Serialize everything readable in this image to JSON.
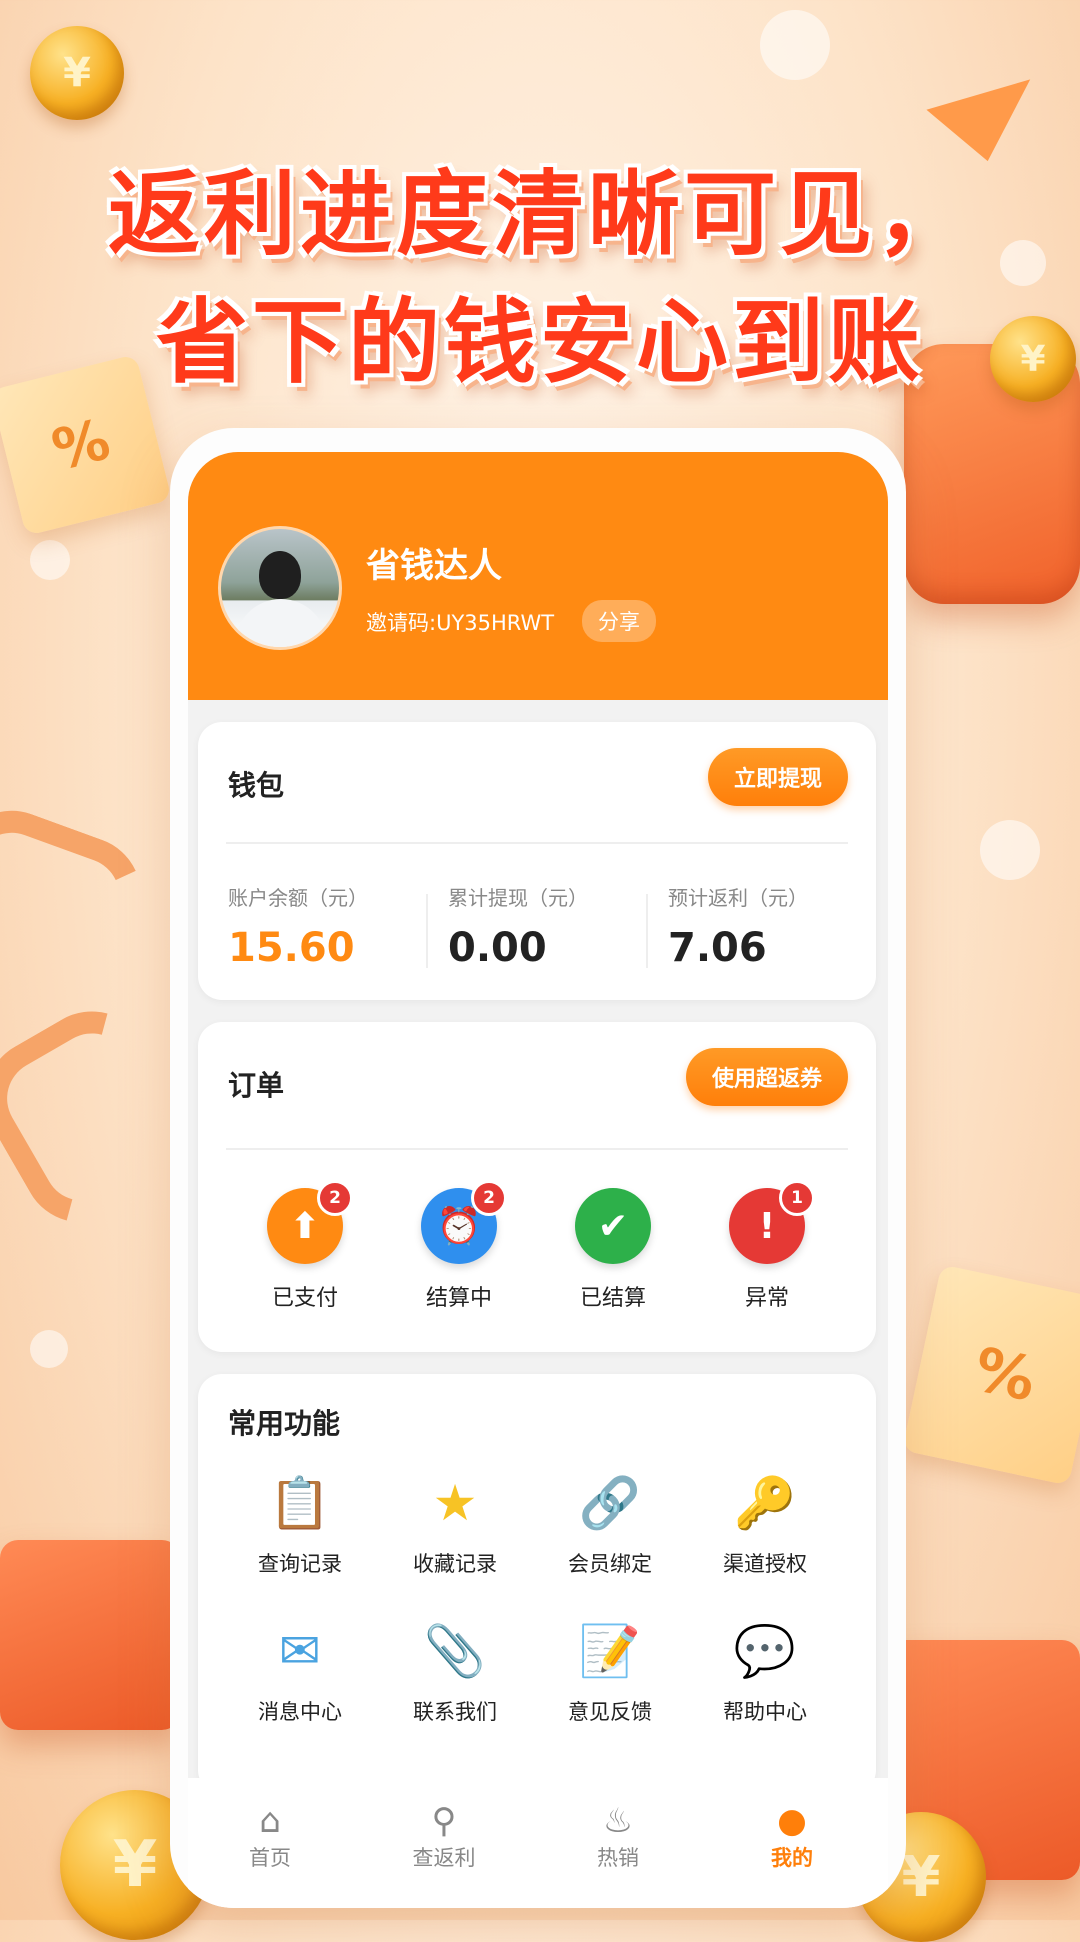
{
  "headline": {
    "line1": "返利进度清晰可见，",
    "line2": "省下的钱安心到账"
  },
  "profile": {
    "name": "省钱达人",
    "invite_label": "邀请码:UY35HRWT",
    "share_label": "分享"
  },
  "wallet": {
    "title": "钱包",
    "withdraw_button": "立即提现",
    "stats": [
      {
        "label": "账户余额（元）",
        "value": "15.60",
        "color": "#ff8a12"
      },
      {
        "label": "累计提现（元）",
        "value": "0.00",
        "color": "#222222"
      },
      {
        "label": "预计返利（元）",
        "value": "7.06",
        "color": "#222222"
      }
    ]
  },
  "orders": {
    "title": "订单",
    "coupon_button": "使用超返券",
    "items": [
      {
        "label": "已支付",
        "badge": "2",
        "icon": "upload-icon",
        "color": "#ff8a12"
      },
      {
        "label": "结算中",
        "badge": "2",
        "icon": "alarm-clock-icon",
        "color": "#2f8fee"
      },
      {
        "label": "已结算",
        "badge": "",
        "icon": "check-icon",
        "color": "#2db04a"
      },
      {
        "label": "异常",
        "badge": "1",
        "icon": "exclamation-icon",
        "color": "#e53935"
      }
    ]
  },
  "functions": {
    "title": "常用功能",
    "items": [
      {
        "label": "查询记录",
        "icon": "clipboard-icon"
      },
      {
        "label": "收藏记录",
        "icon": "star-icon"
      },
      {
        "label": "会员绑定",
        "icon": "link-icon"
      },
      {
        "label": "渠道授权",
        "icon": "key-icon"
      },
      {
        "label": "消息中心",
        "icon": "envelope-icon"
      },
      {
        "label": "联系我们",
        "icon": "paperclip-icon"
      },
      {
        "label": "意见反馈",
        "icon": "memo-icon"
      },
      {
        "label": "帮助中心",
        "icon": "speech-bubble-icon"
      }
    ]
  },
  "tabbar": {
    "tabs": [
      {
        "label": "首页",
        "icon": "home-icon"
      },
      {
        "label": "查返利",
        "icon": "search-icon"
      },
      {
        "label": "热销",
        "icon": "flame-icon"
      },
      {
        "label": "我的",
        "icon": "user-icon",
        "active": true
      }
    ]
  },
  "colors": {
    "accent": "#ff8a12",
    "headline": "#ff3a1a"
  }
}
